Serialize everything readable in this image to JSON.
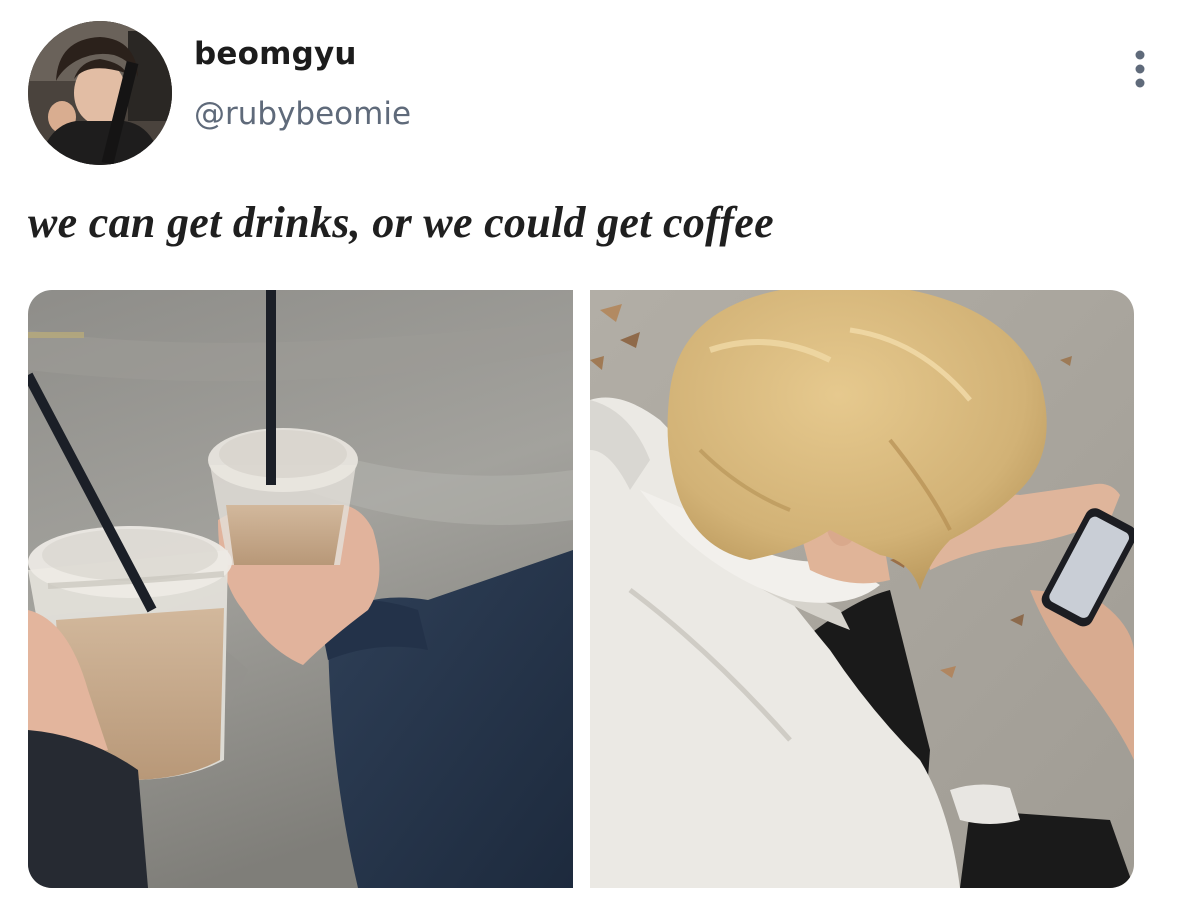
{
  "author": {
    "display_name": "beomgyu",
    "handle": "@rubybeomie",
    "avatar": "profile-photo"
  },
  "post": {
    "text": "we can get drinks, or we could get coffee",
    "menu_icon": "more-vertical-icon"
  },
  "media": [
    {
      "photo": "two-iced-coffees-photo"
    },
    {
      "photo": "blonde-person-on-phone-photo"
    }
  ],
  "colors": {
    "name": "#1c1c1c",
    "handle": "#5f6a7a",
    "post_text": "#1f1f1f",
    "icon": "#5f6a7a"
  }
}
